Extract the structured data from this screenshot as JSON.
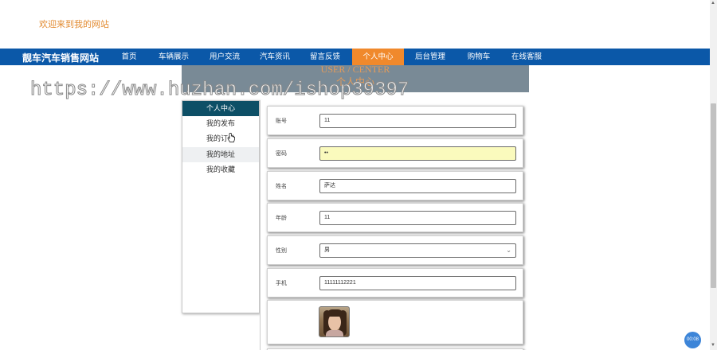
{
  "header": {
    "welcome_text": "欢迎来到我的网站"
  },
  "nav": {
    "brand": "靓车汽车销售网站",
    "items": [
      {
        "label": "首页"
      },
      {
        "label": "车辆展示"
      },
      {
        "label": "用户交流"
      },
      {
        "label": "汽车资讯"
      },
      {
        "label": "留言反馈"
      },
      {
        "label": "个人中心",
        "active": true
      },
      {
        "label": "后台管理"
      },
      {
        "label": "购物车"
      },
      {
        "label": "在线客服"
      }
    ],
    "colors": {
      "bar": "#0b58a8",
      "active": "#f0892c"
    }
  },
  "banner": {
    "title_en": "USER / CENTER",
    "title_zh": "个人中心"
  },
  "watermark": "https://www.huzhan.com/ishop39397",
  "side_menu": {
    "items": [
      {
        "label": "个人中心",
        "active": true
      },
      {
        "label": "我的发布"
      },
      {
        "label": "我的订单"
      },
      {
        "label": "我的地址"
      },
      {
        "label": "我的收藏"
      }
    ]
  },
  "form": {
    "fields": [
      {
        "label": "账号",
        "value": "11"
      },
      {
        "label": "密码",
        "value": "••"
      },
      {
        "label": "姓名",
        "value": "萨达"
      },
      {
        "label": "年龄",
        "value": "11"
      },
      {
        "label": "性别",
        "value": "男"
      },
      {
        "label": "手机",
        "value": "11111112221"
      }
    ]
  },
  "timer_badge": "00:08"
}
